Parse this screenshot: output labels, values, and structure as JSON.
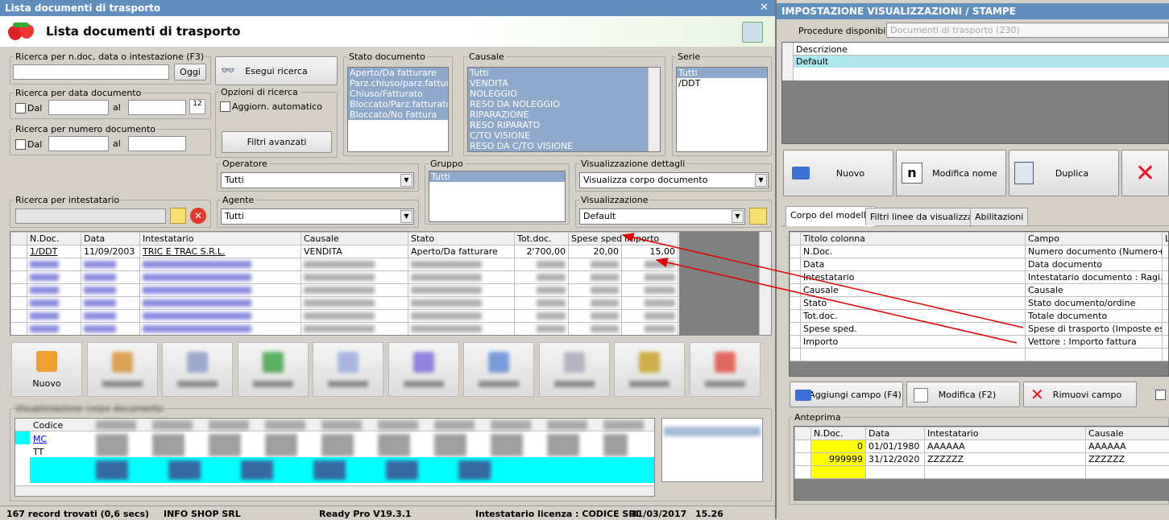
{
  "left_window": {
    "title": "Lista documenti di trasporto",
    "header_title": "Lista documenti di trasporto",
    "search_ndoc": {
      "legend": "Ricerca per n.doc, data o intestazione (F3)",
      "value": "",
      "today_button": "Oggi"
    },
    "search_button": "Esegui ricerca",
    "search_date": {
      "legend": "Ricerca per data documento",
      "from_label": "Dal",
      "to_label": "al"
    },
    "search_number": {
      "legend": "Ricerca per numero documento",
      "from_label": "Dal",
      "to_label": "al"
    },
    "search_options": {
      "legend": "Opzioni di ricerca",
      "auto_update_label": "Aggiorn. automatico"
    },
    "advanced_filters_button": "Filtri avanzati",
    "stato_documento": {
      "legend": "Stato documento",
      "items": [
        "Aperto/Da fatturare",
        "Parz.chiuso/parz.fatturato",
        "Chiuso/Fatturato",
        "Bloccato/Parz.fatturato",
        "Bloccato/No Fattura"
      ]
    },
    "causale": {
      "legend": "Causale",
      "items": [
        "Tutti",
        "VENDITA",
        "NOLEGGIO",
        "RESO DA NOLEGGIO",
        "RIPARAZIONE",
        "RESO RIPARATO",
        "C/TO VISIONE",
        "RESO DA C/TO VISIONE"
      ]
    },
    "serie": {
      "legend": "Serie",
      "items": [
        "Tutti",
        "/DDT"
      ]
    },
    "operatore": {
      "legend": "Operatore",
      "value": "Tutti"
    },
    "agente": {
      "legend": "Agente",
      "value": "Tutti"
    },
    "gruppo": {
      "legend": "Gruppo",
      "items": [
        "Tutti"
      ]
    },
    "visualizzazione_dettagli": {
      "legend": "Visualizzazione dettagli",
      "value": "Visualizza corpo documento"
    },
    "visualizzazione": {
      "legend": "Visualizzazione",
      "value": "Default"
    },
    "search_holder": {
      "legend": "Ricerca per intestatario"
    },
    "main_table": {
      "columns": [
        "N.Doc.",
        "Data",
        "Intestatario",
        "Causale",
        "Stato",
        "Tot.doc.",
        "Spese sped.",
        "Importo"
      ],
      "first_row": [
        "1/DDT",
        "11/09/2003",
        "TRIC E TRAC S.R.L.",
        "VENDITA",
        "Aperto/Da fatturare",
        "2'700,00",
        "20,00",
        "15,00"
      ]
    },
    "toolbar_first_label": "Nuovo",
    "details": {
      "legend": "Visualizzazione corpo documento",
      "first_col": "Codice",
      "row1_code": "MC",
      "row2_code": "TT"
    },
    "status_bar": {
      "records": "167 record trovati (0,6 secs)",
      "company": "INFO SHOP SRL",
      "version": "Ready Pro V19.3.1",
      "license": "Intestatario licenza : CODICE SRL",
      "date": "31/03/2017",
      "time": "15.26"
    }
  },
  "right_window": {
    "title": "IMPOSTAZIONE VISUALIZZAZIONI / STAMPE",
    "procedures_label": "Procedure disponibili :",
    "procedures_value": "Documenti di trasporto (230)",
    "desc_header": "Descrizione",
    "desc_rows": [
      "Default"
    ],
    "buttons": {
      "new": "Nuovo",
      "rename": "Modifica nome",
      "duplicate": "Duplica"
    },
    "tabs": [
      "Corpo del modello",
      "Filtri linee da visualizzare",
      "Abilitazioni"
    ],
    "fields_table": {
      "columns": [
        "Titolo colonna",
        "Campo",
        "L"
      ],
      "rows": [
        [
          "N.Doc.",
          "Numero documento (Numero+..."
        ],
        [
          "Data",
          "Data documento"
        ],
        [
          "Intestatario",
          "Intestatario documento : Ragi..."
        ],
        [
          "Causale",
          "Causale"
        ],
        [
          "Stato",
          "Stato documento/ordine"
        ],
        [
          "Tot.doc.",
          "Totale documento"
        ],
        [
          "Spese sped.",
          "Spese di trasporto (Imposte es..."
        ],
        [
          "Importo",
          "Vettore : Importo fattura"
        ]
      ]
    },
    "field_buttons": {
      "add": "Aggiungi campo (F4)",
      "edit": "Modifica (F2)",
      "remove": "Rimuovi campo"
    },
    "preview": {
      "legend": "Anteprima",
      "columns": [
        "N.Doc.",
        "Data",
        "Intestatario",
        "Causale"
      ],
      "rows": [
        [
          "0",
          "01/01/1980",
          "AAAAAA",
          "AAAAAA"
        ],
        [
          "999999",
          "31/12/2020",
          "ZZZZZZ",
          "ZZZZZZ"
        ]
      ]
    }
  },
  "colors": {
    "title_bar": "#5f8fbf",
    "selection": "#8ea9cc",
    "cyan_row": "#00ffff",
    "yellow_cell": "#ffff00",
    "arrow": "#e00000"
  }
}
